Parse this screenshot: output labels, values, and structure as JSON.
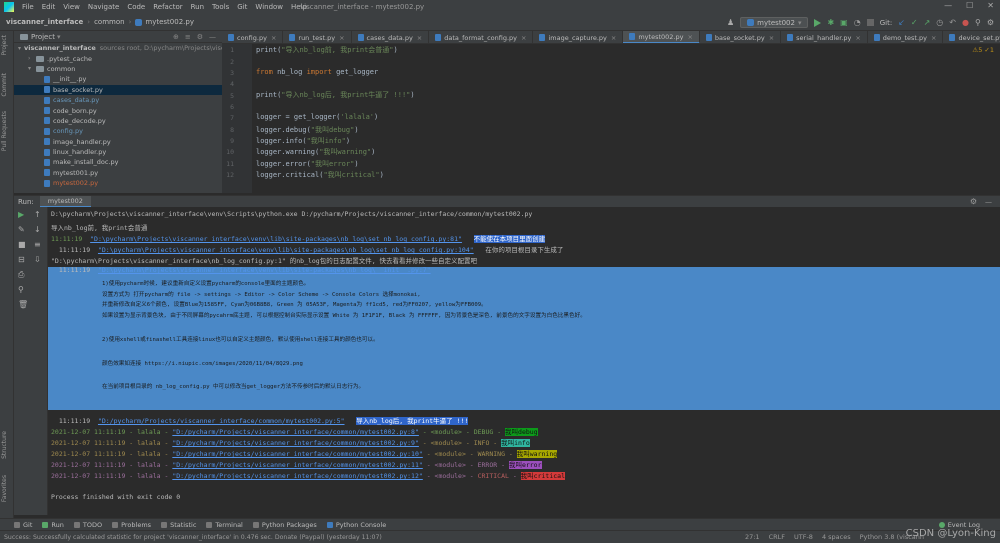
{
  "window": {
    "title": "viscanner_interface - mytest002.py",
    "menu": [
      "File",
      "Edit",
      "View",
      "Navigate",
      "Code",
      "Refactor",
      "Run",
      "Tools",
      "Git",
      "Window",
      "Help"
    ]
  },
  "navbar": {
    "project": "viscanner_interface",
    "folder": "common",
    "file": "mytest002.py",
    "run_config": "mytest002",
    "git_label": "Git:"
  },
  "left_strip": {
    "project": "Project",
    "commit": "Commit",
    "pull_requests": "Pull Requests",
    "structure": "Structure",
    "favorites": "Favorites"
  },
  "project_panel": {
    "title": "Project",
    "root_label": "viscanner_interface",
    "root_path": "sources root, D:\\pycharm\\Projects\\viscan",
    "items": [
      {
        "label": ".pytest_cache",
        "type": "folder"
      },
      {
        "label": "common",
        "type": "folder"
      },
      {
        "label": "__init__.py",
        "type": "py"
      },
      {
        "label": "base_socket.py",
        "type": "py"
      },
      {
        "label": "cases_data.py",
        "type": "py"
      },
      {
        "label": "code_born.py",
        "type": "py"
      },
      {
        "label": "code_decode.py",
        "type": "py"
      },
      {
        "label": "config.py",
        "type": "py"
      },
      {
        "label": "image_handler.py",
        "type": "py"
      },
      {
        "label": "linux_handler.py",
        "type": "py"
      },
      {
        "label": "make_install_doc.py",
        "type": "py"
      },
      {
        "label": "mytest001.py",
        "type": "py"
      },
      {
        "label": "mytest002.py",
        "type": "py"
      }
    ]
  },
  "editor_tabs": [
    "config.py",
    "run_test.py",
    "cases_data.py",
    "data_format_config.py",
    "image_capture.py",
    "mytest002.py",
    "base_socket.py",
    "serial_handler.py",
    "demo_test.py",
    "device_set.py"
  ],
  "editor": {
    "warnings": "⚠5 ✓1",
    "line_numbers": [
      "1",
      "2",
      "3",
      "4",
      "5",
      "6",
      "7",
      "8",
      "9",
      "10",
      "11",
      "12"
    ],
    "code": {
      "l1_fn": "print(",
      "l1_str": "\"导入nb_log前, 我print会普通\"",
      "l1_end": ")",
      "l3_kw1": "from",
      "l3_mid": " nb_log ",
      "l3_kw2": "import",
      "l3_end": " get_logger",
      "l5_fn": "print(",
      "l5_str": "\"导入nb_log后, 我print牛逼了 !!!\"",
      "l5_end": ")",
      "l7_a": "logger = get_logger(",
      "l7_str": "'lalala'",
      "l7_end": ")",
      "l8_a": "logger.debug(",
      "l8_str": "\"我叫debug\"",
      "l8_end": ")",
      "l9_a": "logger.info(",
      "l9_str": "\"我叫info\"",
      "l9_end": ")",
      "l10_a": "logger.warning(",
      "l10_str": "\"我叫warning\"",
      "l10_end": ")",
      "l11_a": "logger.error(",
      "l11_str": "\"我叫error\"",
      "l11_end": ")",
      "l12_a": "logger.critical(",
      "l12_str": "\"我叫critical\"",
      "l12_end": ")"
    }
  },
  "run_panel": {
    "label": "Run:",
    "tab": "mytest002",
    "cmd": "D:\\pycharm\\Projects\\viscanner_interface\\venv\\Scripts\\python.exe D:/pycharm/Projects/viscanner_interface/common/mytest002.py",
    "line_plain": "导入nb_log前, 我print会普通",
    "l3_time": "11:11:19",
    "l3_link": "\"D:\\pycharm\\Projects\\viscanner_interface\\venv\\lib\\site-packages\\nb_log\\set_nb_log_config.py:81\"",
    "l3_msg": "不能使在本项目里面创建",
    "l4_time": "11:11:19",
    "l4_link": "\"D:\\pycharm\\Projects\\viscanner_interface\\venv\\lib\\site-packages\\nb_log\\set_nb_log_config.py:104\"",
    "l4_msg": "在你的项目根目录下生成了",
    "l5": "\"D:\\pycharm\\Projects\\viscanner_interface\\nb_log_config.py:1\" 的nb_log包的日志配置文件, 快去看看并修改一些自定义配置吧",
    "l6_time": "11:11:19",
    "l6_link": "\"D:\\pycharm\\Projects\\viscanner_interface\\venv\\lib\\site-packages\\nb_log\\__init__.py:7\"",
    "block": [
      "1)使用pycharm时候, 建议重新自定义设置pycharm的console里面的主题颜色。",
      "设置方式为 打开pycharm的 file -> settings -> Editor -> Color Scheme -> Console Colors 选择monokai,",
      "并重新修改自定义6个颜色, 设置Blue为1585FF, Cyan为06B8B8, Green 为 05A53F, Magenta为 ff1cd5, red为FF0207, yellow为FFB009。",
      "如果设置为显示背景色块, 由于不同屏幕的pycahrm底主题, 可以根据控制台实际显示设置 White 为 1F1F1F, Black 为 FFFFFF, 因为背景色是深色, 前景色的文字设置为白色比黑色好。",
      "2)使用xshell或finashell工具连接linux也可以自定义主题颜色, 默认使用shell连接工具的颜色也可以。",
      "颜色效果如连接 https://i.niupic.com/images/2020/11/04/8Q29.png",
      "在当前项目根目录的 nb_log_config.py 中可以修改当get_logger方法不传参时后的默认日志行为。"
    ],
    "after_time": "11:11:19",
    "after_link": "\"D:/pycharm/Projects/viscanner_interface/common/mytest002.py:5\"",
    "after_msg": "导入nb_log后, 我print牛逼了 !!!",
    "log_lines": [
      {
        "ts": "2021-12-07 11:11:19",
        "name": "lalala",
        "loc": "\"D:/pycharm/Projects/viscanner_interface/common/mytest002.py:8\"",
        "mod": "<module>",
        "level": "DEBUG",
        "msg": "我叫debug"
      },
      {
        "ts": "2021-12-07 11:11:19",
        "name": "lalala",
        "loc": "\"D:/pycharm/Projects/viscanner_interface/common/mytest002.py:9\"",
        "mod": "<module>",
        "level": "INFO",
        "msg": "我叫info"
      },
      {
        "ts": "2021-12-07 11:11:19",
        "name": "lalala",
        "loc": "\"D:/pycharm/Projects/viscanner_interface/common/mytest002.py:10\"",
        "mod": "<module>",
        "level": "WARNING",
        "msg": "我叫warning"
      },
      {
        "ts": "2021-12-07 11:11:19",
        "name": "lalala",
        "loc": "\"D:/pycharm/Projects/viscanner_interface/common/mytest002.py:11\"",
        "mod": "<module>",
        "level": "ERROR",
        "msg": "我叫error"
      },
      {
        "ts": "2021-12-07 11:11:19",
        "name": "lalala",
        "loc": "\"D:/pycharm/Projects/viscanner_interface/common/mytest002.py:12\"",
        "mod": "<module>",
        "level": "CRITICAL",
        "msg": "我叫critical"
      }
    ],
    "exit": "Process finished with exit code 0"
  },
  "bottom_tabs": [
    "Git",
    "Run",
    "TODO",
    "Problems",
    "Statistic",
    "Terminal",
    "Python Packages",
    "Python Console"
  ],
  "event_log": "Event Log",
  "status": {
    "message": "Success: Successfully calculated statistic for project 'viscanner_interface' in 0.476 sec. Donate (Paypal) (yesterday 11:07)",
    "pos": "27:1",
    "crlf": "CRLF",
    "enc": "UTF-8",
    "indent": "4 spaces",
    "interp": "Python 3.8 (viscann"
  },
  "watermark": "CSDN @Lyon-King",
  "colors": {
    "accent": "#4a88c7",
    "bg": "#2b2b2b",
    "panel": "#3c3f41"
  }
}
